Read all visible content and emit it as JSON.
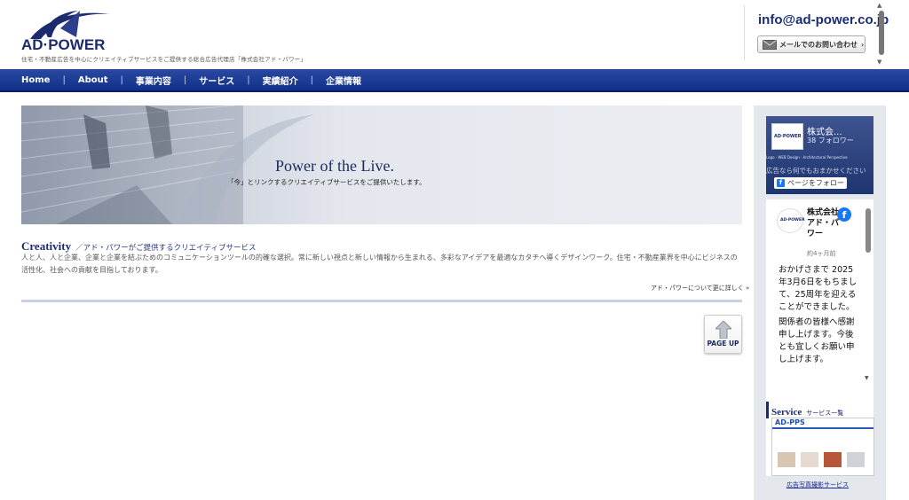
{
  "header": {
    "logo_text": "AD·POWER",
    "tagline": "住宅・不動産広告を中心にクリエイティブサービスをご提供する総合広告代理店「株式会社アド・パワー」",
    "email": "info@ad-power.co.jp",
    "mail_button_label": "メールでのお問い合わせ",
    "mail_button_arrow": "›"
  },
  "nav": {
    "items": [
      {
        "label": "Home"
      },
      {
        "label": "About"
      },
      {
        "label": "事業内容"
      },
      {
        "label": "サービス"
      },
      {
        "label": "実績紹介"
      },
      {
        "label": "企業情報"
      }
    ],
    "separator": "|"
  },
  "hero": {
    "title": "Power of the Live.",
    "subtitle": "「今」とリンクするクリエイティブサービスをご提供いたします。"
  },
  "intro": {
    "heading": "Creativity",
    "heading_sub": "／アド・パワーがご提供するクリエイティブサービス",
    "body": "人と人、人と企業、企業と企業を結ぶためのコミュニケーションツールの的確な選択。常に新しい視点と新しい情報から生まれる、多彩なアイデアを最適なカタチへ導くデザインワーク。住宅・不動産業界を中心にビジネスの活性化、社会への貢献を目指しております。",
    "more_link": "アド・パワーについて更に詳しく »"
  },
  "page_up": {
    "label": "PAGE UP"
  },
  "facebook": {
    "page_name": "株式会...",
    "followers": "38 フォロワー",
    "cover_strip": "Logo · WEB Design · Architectural Perspective",
    "cover_faint": "広告なら何でもおまかせください",
    "follow_button": "ページをフォロー",
    "post_author": "株式会社アド・パワー",
    "post_time": "約4ヶ月前",
    "post_paragraphs": [
      "おかげさまで 2025年3月6日をもちまして、25周年を迎えることができました。",
      "関係者の皆様へ感謝申し上げます。今後とも宜しくお願い申し上げます。"
    ]
  },
  "sidebar": {
    "service_heading": "Service",
    "service_sub": "サービス一覧",
    "service_image_label": "AD-PPS",
    "service_caption": "広告写真撮影サービス"
  },
  "colors": {
    "brand_navy": "#1c2b6e",
    "nav_blue": "#1a3a94",
    "facebook_blue": "#1877f2",
    "sidebar_bg": "#e4e7ec"
  }
}
